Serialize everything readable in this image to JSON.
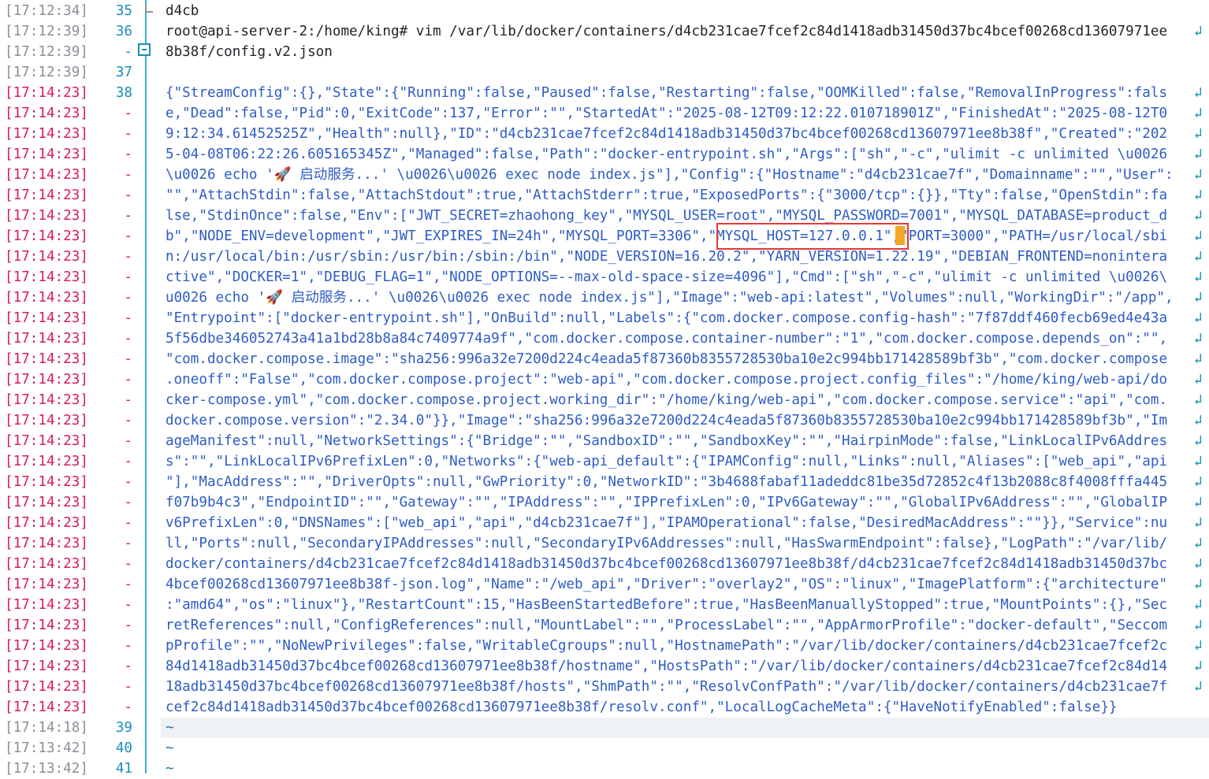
{
  "lines": [
    {
      "ts": "[17:12:34]",
      "ln": "35",
      "text": "d4cb",
      "hot": false
    },
    {
      "ts": "[17:12:39]",
      "ln": "36",
      "text": "root@api-server-2:/home/king# vim /var/lib/docker/containers/d4cb231cae7fcef2c84d1418adb31450d37bc4bcef00268cd13607971ee",
      "hot": false
    },
    {
      "ts": "[17:12:39]",
      "ln": "-",
      "text": "8b38f/config.v2.json",
      "hot": false
    },
    {
      "ts": "[17:12:39]",
      "ln": "37",
      "text": "",
      "hot": false
    },
    {
      "ts": "[17:14:23]",
      "ln": "38",
      "text": "{\"StreamConfig\":{},\"State\":{\"Running\":false,\"Paused\":false,\"Restarting\":false,\"OOMKilled\":false,\"RemovalInProgress\":fals",
      "hot": true
    },
    {
      "ts": "[17:14:23]",
      "ln": "-",
      "text": "e,\"Dead\":false,\"Pid\":0,\"ExitCode\":137,\"Error\":\"\",\"StartedAt\":\"2025-08-12T09:12:22.010718901Z\",\"FinishedAt\":\"2025-08-12T0",
      "hot": true
    },
    {
      "ts": "[17:14:23]",
      "ln": "-",
      "text": "9:12:34.61452525Z\",\"Health\":null},\"ID\":\"d4cb231cae7fcef2c84d1418adb31450d37bc4bcef00268cd13607971ee8b38f\",\"Created\":\"202",
      "hot": true
    },
    {
      "ts": "[17:14:23]",
      "ln": "-",
      "text": "5-04-08T06:22:26.605165345Z\",\"Managed\":false,\"Path\":\"docker-entrypoint.sh\",\"Args\":[\"sh\",\"-c\",\"ulimit -c unlimited \\u0026",
      "hot": true
    },
    {
      "ts": "[17:14:23]",
      "ln": "-",
      "text": "\\u0026 echo '🚀 启动服务...' \\u0026\\u0026 exec node index.js\"],\"Config\":{\"Hostname\":\"d4cb231cae7f\",\"Domainname\":\"\",\"User\":",
      "hot": true
    },
    {
      "ts": "[17:14:23]",
      "ln": "-",
      "text": "\"\",\"AttachStdin\":false,\"AttachStdout\":true,\"AttachStderr\":true,\"ExposedPorts\":{\"3000/tcp\":{}},\"Tty\":false,\"OpenStdin\":fa",
      "hot": true
    },
    {
      "ts": "[17:14:23]",
      "ln": "-",
      "text": "lse,\"StdinOnce\":false,\"Env\":[\"JWT_SECRET=zhaohong_key\",\"MYSQL_USER=root\",\"MYSQL_PASSWORD=7001\",\"MYSQL_DATABASE=product_d",
      "hot": true
    },
    {
      "ts": "[17:14:23]",
      "ln": "-",
      "text": "b\",\"NODE_ENV=development\",\"JWT_EXPIRES_IN=24h\",\"MYSQL_PORT=3306\",\"MYSQL_HOST=127.0.0.1\",\"PORT=3000\",\"PATH=/usr/local/sbi",
      "hot": true
    },
    {
      "ts": "[17:14:23]",
      "ln": "-",
      "text": "n:/usr/local/bin:/usr/sbin:/usr/bin:/sbin:/bin\",\"NODE_VERSION=16.20.2\",\"YARN_VERSION=1.22.19\",\"DEBIAN_FRONTEND=nonintera",
      "hot": true
    },
    {
      "ts": "[17:14:23]",
      "ln": "-",
      "text": "ctive\",\"DOCKER=1\",\"DEBUG_FLAG=1\",\"NODE_OPTIONS=--max-old-space-size=4096\"],\"Cmd\":[\"sh\",\"-c\",\"ulimit -c unlimited \\u0026\\",
      "hot": true
    },
    {
      "ts": "[17:14:23]",
      "ln": "-",
      "text": "u0026 echo '🚀 启动服务...' \\u0026\\u0026 exec node index.js\"],\"Image\":\"web-api:latest\",\"Volumes\":null,\"WorkingDir\":\"/app\",",
      "hot": true
    },
    {
      "ts": "[17:14:23]",
      "ln": "-",
      "text": "\"Entrypoint\":[\"docker-entrypoint.sh\"],\"OnBuild\":null,\"Labels\":{\"com.docker.compose.config-hash\":\"7f87ddf460fecb69ed4e43a",
      "hot": true
    },
    {
      "ts": "[17:14:23]",
      "ln": "-",
      "text": "5f56dbe346052743a41a1bd28b8a84c7409774a9f\",\"com.docker.compose.container-number\":\"1\",\"com.docker.compose.depends_on\":\"\",",
      "hot": true
    },
    {
      "ts": "[17:14:23]",
      "ln": "-",
      "text": "\"com.docker.compose.image\":\"sha256:996a32e7200d224c4eada5f87360b8355728530ba10e2c994bb171428589bf3b\",\"com.docker.compose",
      "hot": true
    },
    {
      "ts": "[17:14:23]",
      "ln": "-",
      "text": ".oneoff\":\"False\",\"com.docker.compose.project\":\"web-api\",\"com.docker.compose.project.config_files\":\"/home/king/web-api/do",
      "hot": true
    },
    {
      "ts": "[17:14:23]",
      "ln": "-",
      "text": "cker-compose.yml\",\"com.docker.compose.project.working_dir\":\"/home/king/web-api\",\"com.docker.compose.service\":\"api\",\"com.",
      "hot": true
    },
    {
      "ts": "[17:14:23]",
      "ln": "-",
      "text": "docker.compose.version\":\"2.34.0\"}},\"Image\":\"sha256:996a32e7200d224c4eada5f87360b8355728530ba10e2c994bb171428589bf3b\",\"Im",
      "hot": true
    },
    {
      "ts": "[17:14:23]",
      "ln": "-",
      "text": "ageManifest\":null,\"NetworkSettings\":{\"Bridge\":\"\",\"SandboxID\":\"\",\"SandboxKey\":\"\",\"HairpinMode\":false,\"LinkLocalIPv6Addres",
      "hot": true
    },
    {
      "ts": "[17:14:23]",
      "ln": "-",
      "text": "s\":\"\",\"LinkLocalIPv6PrefixLen\":0,\"Networks\":{\"web-api_default\":{\"IPAMConfig\":null,\"Links\":null,\"Aliases\":[\"web_api\",\"api",
      "hot": true
    },
    {
      "ts": "[17:14:23]",
      "ln": "-",
      "text": "\"],\"MacAddress\":\"\",\"DriverOpts\":null,\"GwPriority\":0,\"NetworkID\":\"3b4688fabaf11adeddc81be35d72852c4f13b2088c8f4008fffa445",
      "hot": true
    },
    {
      "ts": "[17:14:23]",
      "ln": "-",
      "text": "f07b9b4c3\",\"EndpointID\":\"\",\"Gateway\":\"\",\"IPAddress\":\"\",\"IPPrefixLen\":0,\"IPv6Gateway\":\"\",\"GlobalIPv6Address\":\"\",\"GlobalIP",
      "hot": true
    },
    {
      "ts": "[17:14:23]",
      "ln": "-",
      "text": "v6PrefixLen\":0,\"DNSNames\":[\"web_api\",\"api\",\"d4cb231cae7f\"],\"IPAMOperational\":false,\"DesiredMacAddress\":\"\"}},\"Service\":nu",
      "hot": true
    },
    {
      "ts": "[17:14:23]",
      "ln": "-",
      "text": "ll,\"Ports\":null,\"SecondaryIPAddresses\":null,\"SecondaryIPv6Addresses\":null,\"HasSwarmEndpoint\":false},\"LogPath\":\"/var/lib/",
      "hot": true
    },
    {
      "ts": "[17:14:23]",
      "ln": "-",
      "text": "docker/containers/d4cb231cae7fcef2c84d1418adb31450d37bc4bcef00268cd13607971ee8b38f/d4cb231cae7fcef2c84d1418adb31450d37bc",
      "hot": true
    },
    {
      "ts": "[17:14:23]",
      "ln": "-",
      "text": "4bcef00268cd13607971ee8b38f-json.log\",\"Name\":\"/web_api\",\"Driver\":\"overlay2\",\"OS\":\"linux\",\"ImagePlatform\":{\"architecture\"",
      "hot": true
    },
    {
      "ts": "[17:14:23]",
      "ln": "-",
      "text": ":\"amd64\",\"os\":\"linux\"},\"RestartCount\":15,\"HasBeenStartedBefore\":true,\"HasBeenManuallyStopped\":true,\"MountPoints\":{},\"Sec",
      "hot": true
    },
    {
      "ts": "[17:14:23]",
      "ln": "-",
      "text": "retReferences\":null,\"ConfigReferences\":null,\"MountLabel\":\"\",\"ProcessLabel\":\"\",\"AppArmorProfile\":\"docker-default\",\"Seccom",
      "hot": true
    },
    {
      "ts": "[17:14:23]",
      "ln": "-",
      "text": "pProfile\":\"\",\"NoNewPrivileges\":false,\"WritableCgroups\":null,\"HostnamePath\":\"/var/lib/docker/containers/d4cb231cae7fcef2c",
      "hot": true
    },
    {
      "ts": "[17:14:23]",
      "ln": "-",
      "text": "84d1418adb31450d37bc4bcef00268cd13607971ee8b38f/hostname\",\"HostsPath\":\"/var/lib/docker/containers/d4cb231cae7fcef2c84d14",
      "hot": true
    },
    {
      "ts": "[17:14:23]",
      "ln": "-",
      "text": "18adb31450d37bc4bcef00268cd13607971ee8b38f/hosts\",\"ShmPath\":\"\",\"ResolvConfPath\":\"/var/lib/docker/containers/d4cb231cae7f",
      "hot": true
    },
    {
      "ts": "[17:14:23]",
      "ln": "-",
      "text": "cef2c84d1418adb31450d37bc4bcef00268cd13607971ee8b38f/resolv.conf\",\"LocalLogCacheMeta\":{\"HaveNotifyEnabled\":false}}",
      "hot": true
    },
    {
      "ts": "[17:14:18]",
      "ln": "39",
      "text": "~",
      "hot": false
    },
    {
      "ts": "[17:13:42]",
      "ln": "40",
      "text": "~",
      "hot": false
    },
    {
      "ts": "[17:13:42]",
      "ln": "41",
      "text": "~",
      "hot": false
    }
  ],
  "wrap_marker": "↲",
  "highlighted_value": "\"MYSQL_HOST=127.0.0.1\"",
  "colors": {
    "accent": "#36b3d6",
    "timestamp_hot": "#d81b60",
    "highlight_box": "#e53935",
    "cursor": "#f5a623"
  }
}
